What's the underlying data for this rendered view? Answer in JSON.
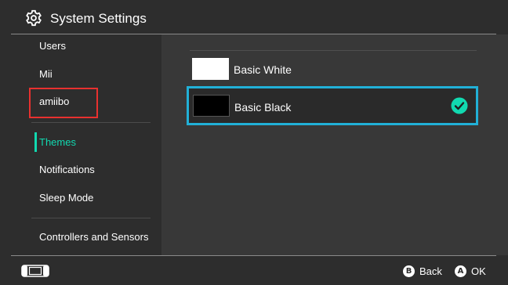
{
  "header": {
    "title": "System Settings",
    "icon": "gear-icon"
  },
  "sidebar": {
    "items": [
      {
        "label": "Users"
      },
      {
        "label": "Mii"
      },
      {
        "label": "amiibo"
      },
      {
        "label": "Themes",
        "selected": true
      },
      {
        "label": "Notifications"
      },
      {
        "label": "Sleep Mode"
      },
      {
        "label": "Controllers and Sensors"
      }
    ],
    "selected_color": "#11d9b0"
  },
  "themes": {
    "options": [
      {
        "label": "Basic White",
        "swatch_color": "#ffffff",
        "selected": false
      },
      {
        "label": "Basic Black",
        "swatch_color": "#000000",
        "selected": true
      }
    ],
    "selected_border_color": "#21b0d7",
    "check_color": "#11d9b0"
  },
  "annotation": {
    "color": "#e8312f"
  },
  "footer": {
    "console_icon": "console-icon",
    "back": {
      "button": "B",
      "label": "Back"
    },
    "ok": {
      "button": "A",
      "label": "OK"
    }
  }
}
